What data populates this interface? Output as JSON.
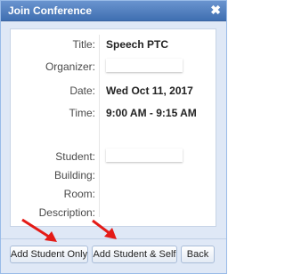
{
  "window": {
    "title": "Join Conference",
    "close_glyph": "✖"
  },
  "fields": [
    {
      "label": "Title:",
      "value": "Speech PTC"
    },
    {
      "label": "Organizer:",
      "value": ""
    },
    {
      "label": "Date:",
      "value": "Wed Oct 11, 2017"
    },
    {
      "label": "Time:",
      "value": "9:00 AM - 9:15 AM"
    },
    {
      "label": "Student:",
      "value": ""
    },
    {
      "label": "Building:",
      "value": ""
    },
    {
      "label": "Room:",
      "value": ""
    },
    {
      "label": "Description:",
      "value": ""
    }
  ],
  "buttons": {
    "add_student_only": "Add Student Only",
    "add_student_self": "Add Student & Self",
    "back": "Back"
  },
  "annotations": {
    "arrow_color": "#e41b17"
  }
}
